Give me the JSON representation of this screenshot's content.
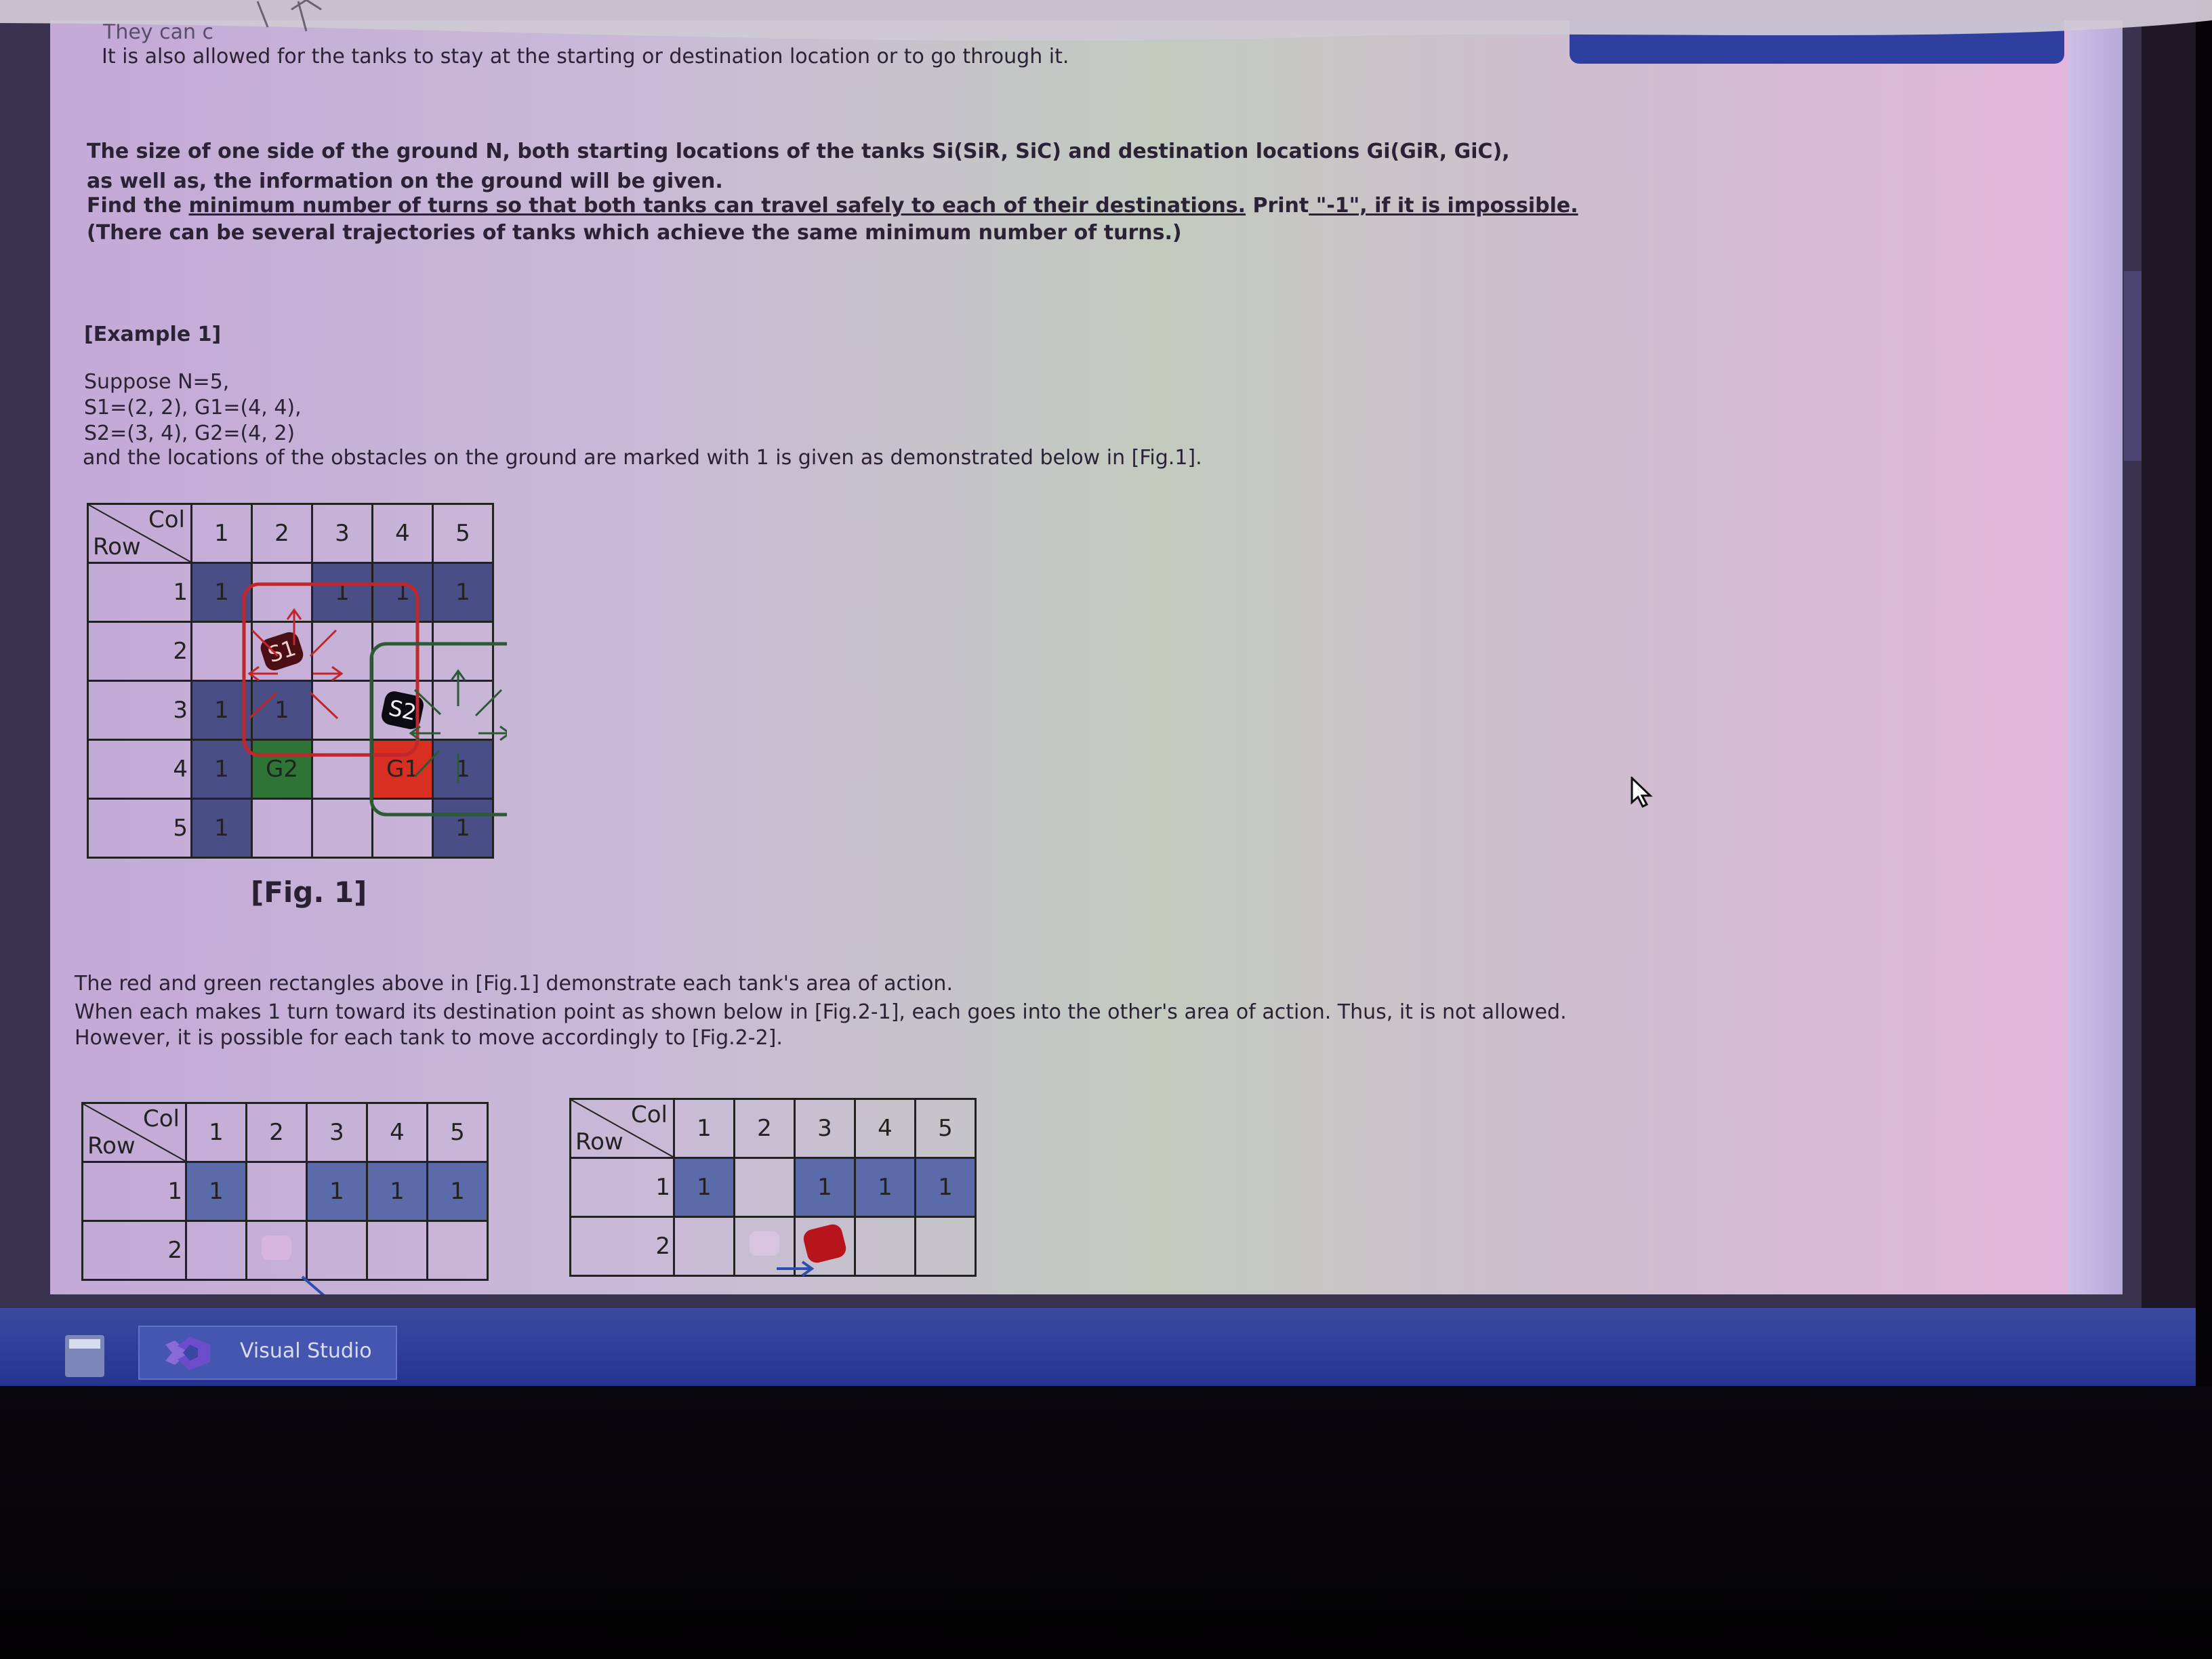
{
  "document": {
    "top_lines": [
      "They can c",
      "It is also allowed for the tanks to stay at the starting or destination location or to go through it."
    ],
    "intro": {
      "line1": "The size of one side of the ground N, both starting locations of the tanks Si(SiR, SiC) and destination locations Gi(GiR, GiC),",
      "line2": "as well as, the information on the ground will be given.",
      "line3_prefix": "Find the ",
      "line3_u1": "minimum number of turns so that both tanks can travel safely to each of their destinations.",
      "line3_mid": " Print",
      "line3_u2": " \"-1\", if it is impossible.",
      "line4": "(There can be several trajectories of tanks which achieve the same minimum number of turns.)"
    },
    "example_heading": "[Example 1]",
    "example_lines": [
      "Suppose N=5,",
      "S1=(2, 2), G1=(4, 4),",
      "S2=(3, 4), G2=(4, 2)",
      "and the locations of the obstacles on the ground are marked with 1 is given as demonstrated below in [Fig.1]."
    ],
    "fig1_caption": "[Fig. 1]",
    "explain_lines": [
      "The red and green rectangles above in [Fig.1] demonstrate each tank's area of action.",
      "When each makes 1 turn toward its destination point as shown below in [Fig.2-1], each goes into the other's area of action. Thus, it is not allowed.",
      "However, it is possible for each tank to move accordingly to [Fig.2-2]."
    ]
  },
  "grid_header": {
    "col_label": "Col",
    "row_label": "Row",
    "cols": [
      "1",
      "2",
      "3",
      "4",
      "5"
    ],
    "rows": [
      "1",
      "2",
      "3",
      "4",
      "5"
    ]
  },
  "fig1_cells": {
    "r1": [
      "1",
      "",
      "1",
      "1",
      "1"
    ],
    "r2": [
      "",
      "S1",
      "",
      "",
      ""
    ],
    "r3": [
      "1",
      "1",
      "",
      "S2",
      ""
    ],
    "r4": [
      "1",
      "G2",
      "",
      "G1",
      "1"
    ],
    "r5": [
      "1",
      "",
      "",
      "",
      "1"
    ]
  },
  "fig2_cells": {
    "r1": [
      "1",
      "",
      "1",
      "1",
      "1"
    ]
  },
  "taskbar": {
    "app_label": "Visual Studio"
  },
  "colors": {
    "obstacle": "#4a4e86",
    "goal1": "#d92f23",
    "goal2": "#2d7436",
    "area_red": "#c0262b",
    "area_green": "#2b5a35",
    "taskbar": "#2a3790"
  }
}
